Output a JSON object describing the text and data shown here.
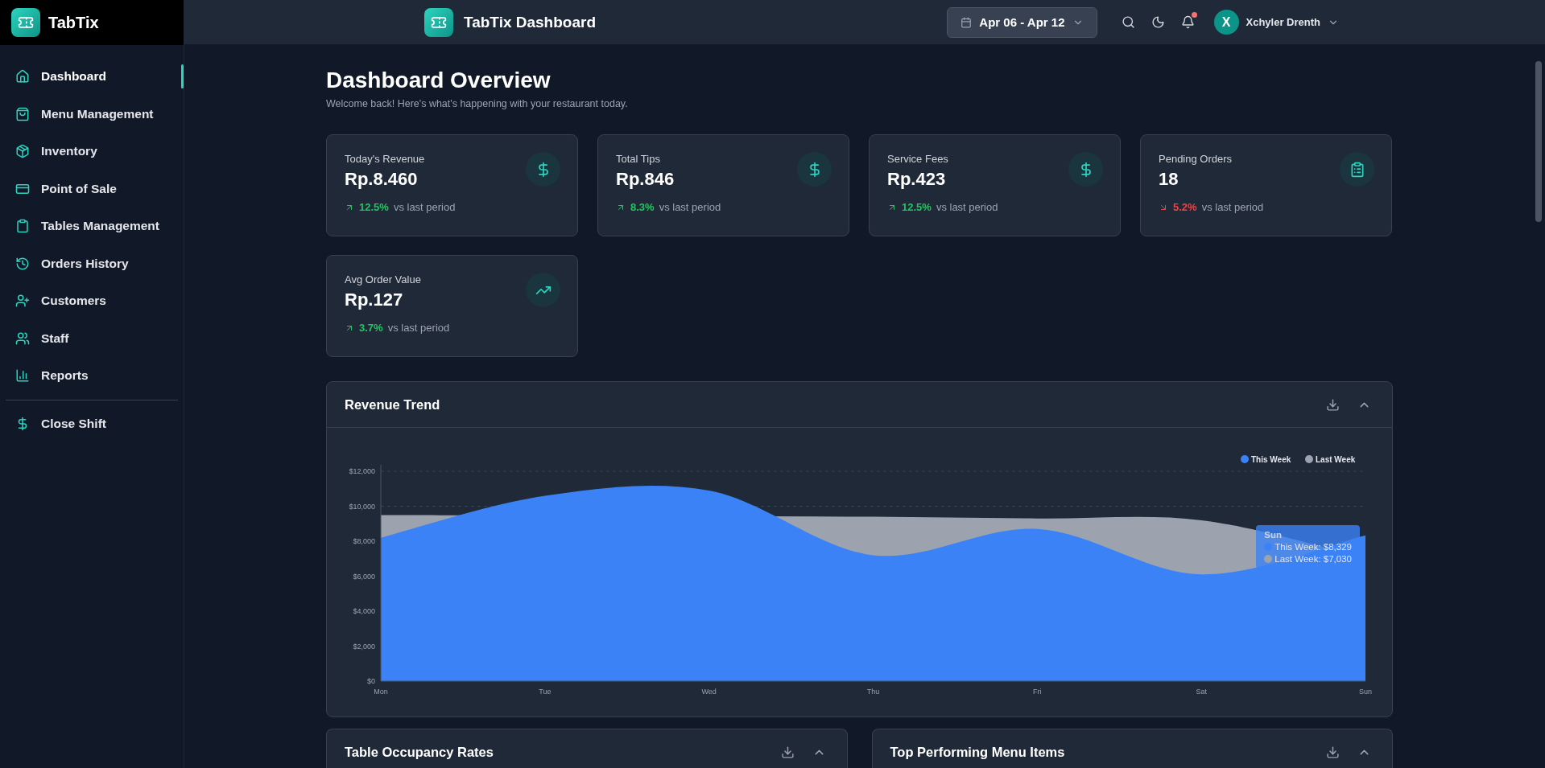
{
  "sidebar": {
    "brand": "TabTix",
    "items": [
      {
        "label": "Dashboard",
        "selected": true
      },
      {
        "label": "Menu Management",
        "selected": false
      },
      {
        "label": "Inventory",
        "selected": false
      },
      {
        "label": "Point of Sale",
        "selected": false
      },
      {
        "label": "Tables Management",
        "selected": false
      },
      {
        "label": "Orders History",
        "selected": false
      },
      {
        "label": "Customers",
        "selected": false
      },
      {
        "label": "Staff",
        "selected": false
      },
      {
        "label": "Reports",
        "selected": false
      }
    ],
    "footer_item": {
      "label": "Close Shift"
    }
  },
  "header": {
    "title": "TabTix Dashboard",
    "date_range": "Apr 06 - Apr 12",
    "notification_unread": true,
    "user": {
      "initial": "X",
      "name": "Xchyler Drenth"
    }
  },
  "page": {
    "title": "Dashboard Overview",
    "subtitle": "Welcome back! Here's what's happening with your restaurant today."
  },
  "stats": [
    {
      "label": "Today's Revenue",
      "value": "Rp.8.460",
      "change": "12.5%",
      "kind": "up",
      "note": "vs last period"
    },
    {
      "label": "Total Tips",
      "value": "Rp.846",
      "change": "8.3%",
      "kind": "up",
      "note": "vs last period"
    },
    {
      "label": "Service Fees",
      "value": "Rp.423",
      "change": "12.5%",
      "kind": "up",
      "note": "vs last period"
    },
    {
      "label": "Pending Orders",
      "value": "18",
      "change": "5.2%",
      "kind": "down",
      "note": "vs last period"
    },
    {
      "label": "Avg Order Value",
      "value": "Rp.127",
      "change": "3.7%",
      "kind": "up",
      "note": "vs last period"
    }
  ],
  "revenue_trend": {
    "title": "Revenue Trend",
    "tooltip": {
      "title": "Sun",
      "lines": [
        "This Week: $8,329",
        "Last Week: $7,030"
      ]
    },
    "chart_data": {
      "type": "area",
      "categories": [
        "Mon",
        "Tue",
        "Wed",
        "Thu",
        "Fri",
        "Sat",
        "Sun"
      ],
      "series": [
        {
          "name": "Last Week",
          "color": "#9ca3af",
          "values": [
            9500,
            null,
            null,
            9400,
            null,
            9200,
            7030
          ]
        },
        {
          "name": "This Week",
          "color": "#3b82f6",
          "values": [
            8200,
            10600,
            10900,
            7200,
            8700,
            6100,
            8329
          ]
        }
      ],
      "ylim": [
        0,
        12000
      ],
      "legend": "top-right",
      "yticks": [
        {
          "value": 0,
          "label": "$0"
        },
        {
          "value": 2000,
          "label": "$2,000"
        },
        {
          "value": 4000,
          "label": "$4,000"
        },
        {
          "value": 6000,
          "label": "$6,000"
        },
        {
          "value": 8000,
          "label": "$8,000"
        },
        {
          "value": 10000,
          "label": "$10,000"
        },
        {
          "value": 12000,
          "label": "$12,000"
        }
      ]
    }
  },
  "bottom_panels": [
    {
      "title": "Table Occupancy Rates"
    },
    {
      "title": "Top Performing Menu Items"
    }
  ]
}
